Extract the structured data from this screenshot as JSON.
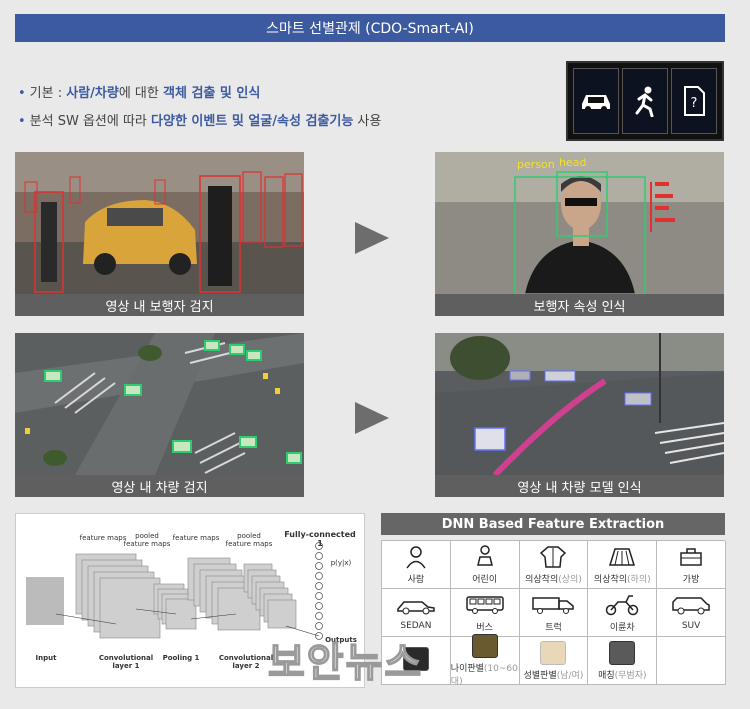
{
  "title": "스마트 선별관제 (CDO-Smart-AI)",
  "bullets": [
    {
      "prefix": "기본 : ",
      "hl1": "사람/차량",
      "mid": "에 대한 ",
      "hl2": "객체 검출 및 인식",
      "suffix": ""
    },
    {
      "prefix": "분석 SW 옵션에 따라 ",
      "hl1": "다양한 이벤트 및 얼굴/속성 검출기능",
      "mid": " 사용",
      "hl2": "",
      "suffix": ""
    }
  ],
  "icons": [
    "car-icon",
    "running-person-icon",
    "unknown-sd-card-icon"
  ],
  "panels": {
    "pedestrian_detect": {
      "caption": "영상 내 보행자 검지"
    },
    "pedestrian_attr": {
      "caption": "보행자 속성 인식",
      "label_person": "person",
      "label_head": "head"
    },
    "vehicle_detect": {
      "caption": "영상 내 차량 검지"
    },
    "vehicle_model": {
      "caption": "영상 내 차량 모델 인식"
    }
  },
  "cnn": {
    "labels": {
      "feature_maps_1": "feature maps",
      "pooled_1": "pooled feature maps",
      "feature_maps_2": "feature maps",
      "pooled_2": "pooled feature maps",
      "fc": "Fully-connected 1",
      "pyx": "p(y|x)",
      "outputs": "Outputs",
      "input": "Input",
      "conv1": "Convolutional layer 1",
      "pool1": "Pooling 1",
      "conv2": "Convolutional layer 2"
    }
  },
  "dnn": {
    "header": "DNN Based Feature Extraction",
    "row1": [
      {
        "label": "사람",
        "gray": "",
        "icon": "person-icon"
      },
      {
        "label": "어린이",
        "gray": "",
        "icon": "child-icon"
      },
      {
        "label": "의상착의",
        "gray": "(상의)",
        "icon": "jacket-icon"
      },
      {
        "label": "의상착의",
        "gray": "(하의)",
        "icon": "skirt-icon"
      },
      {
        "label": "가방",
        "gray": "",
        "icon": "bag-icon"
      }
    ],
    "row2": [
      {
        "label": "SEDAN",
        "gray": "",
        "icon": "sedan-icon"
      },
      {
        "label": "버스",
        "gray": "",
        "icon": "bus-icon"
      },
      {
        "label": "트럭",
        "gray": "",
        "icon": "truck-icon"
      },
      {
        "label": "이륜차",
        "gray": "",
        "icon": "scooter-icon"
      },
      {
        "label": "SUV",
        "gray": "",
        "icon": "suv-icon"
      }
    ],
    "row3": [
      {
        "label": "",
        "gray": "",
        "icon": "face-photo-icon"
      },
      {
        "label": "나이판별",
        "gray": "(10~60대)",
        "icon": "face-photo-icon"
      },
      {
        "label": "성별판별",
        "gray": "(남/여)",
        "icon": "face-photo-icon"
      },
      {
        "label": "매칭",
        "gray": "(무범자)",
        "icon": "face-photo-icon"
      },
      {
        "label": "",
        "gray": "",
        "icon": ""
      }
    ]
  },
  "watermark": "보안뉴스",
  "colors": {
    "accent": "#3c5aa0",
    "caption_bg": "#5f5f5f"
  }
}
